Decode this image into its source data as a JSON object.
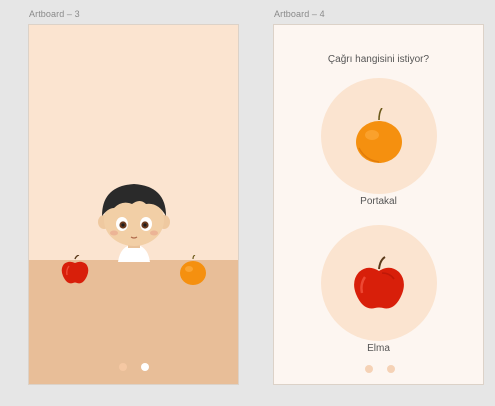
{
  "artboards": [
    {
      "label": "Artboard – 3"
    },
    {
      "label": "Artboard – 4"
    }
  ],
  "screen2": {
    "question": "Çağrı hangisini istiyor?",
    "choices": [
      {
        "label": "Portakal",
        "icon": "orange-icon"
      },
      {
        "label": "Elma",
        "icon": "apple-icon"
      }
    ]
  },
  "pagination": {
    "total": 2,
    "active": 2
  },
  "colors": {
    "background": "#e6e6e6",
    "screen1_wall": "#fbe4d0",
    "screen1_table": "#e8be98",
    "screen2_bg": "#fdf6f1",
    "choice_circle": "#fbe4d0",
    "orange": "#f5900f",
    "apple": "#d81f0a"
  }
}
